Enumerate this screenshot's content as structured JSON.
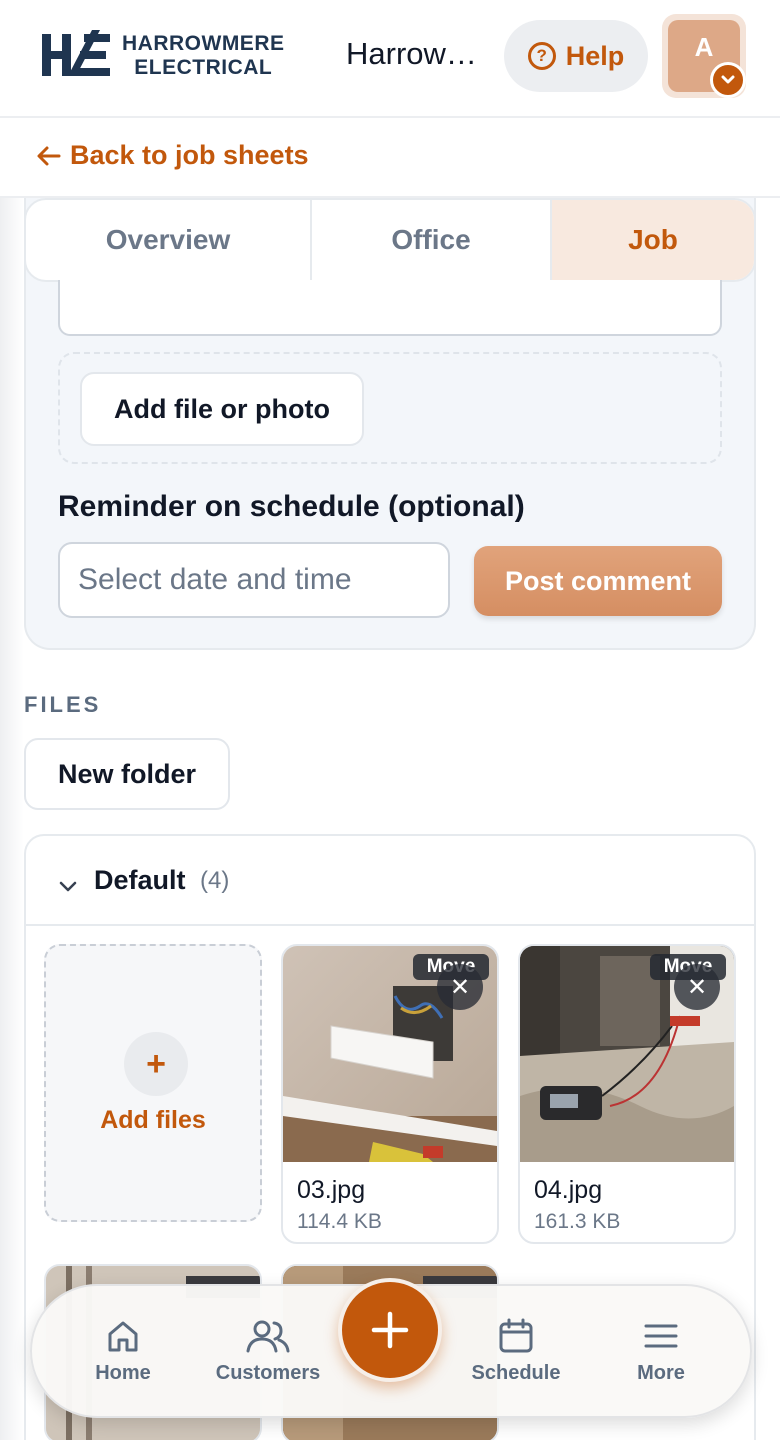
{
  "header": {
    "logo_line1": "HARROWMERE",
    "logo_line2": "ELECTRICAL",
    "title": "Harrowmere Electrical",
    "help_label": "Help",
    "avatar_initial": "A"
  },
  "nav": {
    "back_label": "Back to job sheets"
  },
  "tabs": [
    {
      "label": "Overview",
      "active": false
    },
    {
      "label": "Office",
      "active": false
    },
    {
      "label": "Job",
      "active": true
    }
  ],
  "comment_form": {
    "add_file_label": "Add file or photo",
    "reminder_label": "Reminder on schedule (optional)",
    "date_placeholder": "Select date and time",
    "post_label": "Post comment"
  },
  "files": {
    "heading": "FILES",
    "new_folder_label": "New folder",
    "folder": {
      "name": "Default",
      "count": "(4)",
      "add_files_label": "Add files",
      "items": [
        {
          "name": "03.jpg",
          "size": "114.4 KB",
          "move_label": "Move"
        },
        {
          "name": "04.jpg",
          "size": "161.3 KB",
          "move_label": "Move"
        }
      ]
    }
  },
  "bottom_nav": {
    "items": [
      {
        "label": "Home",
        "icon": "home-icon"
      },
      {
        "label": "Customers",
        "icon": "users-icon"
      },
      {
        "label": "Schedule",
        "icon": "calendar-icon"
      },
      {
        "label": "More",
        "icon": "menu-icon"
      }
    ],
    "fab_icon": "plus-icon"
  },
  "colors": {
    "accent": "#c2580c",
    "accent_soft": "#f8e9df",
    "brand_navy": "#1f3550",
    "muted_text": "#6b7788"
  }
}
